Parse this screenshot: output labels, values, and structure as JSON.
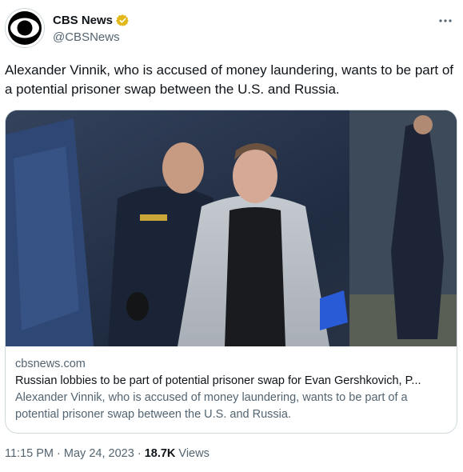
{
  "author": {
    "display_name": "CBS News",
    "handle": "@CBSNews",
    "avatar_icon": "cbs-eye-logo-icon",
    "verified_icon": "verified-gold-badge-icon",
    "verified_color": "#e2b719"
  },
  "more_icon": "more-options-icon",
  "tweet": {
    "text": "Alexander Vinnik, who is accused of money laundering, wants to be part of a potential prisoner swap between the U.S. and Russia."
  },
  "card": {
    "domain": "cbsnews.com",
    "title": "Russian lobbies to be part of potential prisoner swap for Evan Gershkovich, P...",
    "description": "Alexander Vinnik, who is accused of money laundering, wants to be part of a potential prisoner swap between the U.S. and Russia."
  },
  "footer": {
    "time": "11:15 PM",
    "separator": "·",
    "date": "May 24, 2023",
    "views_count": "18.7K",
    "views_label": "Views"
  },
  "colors": {
    "text_primary": "#0f1419",
    "text_secondary": "#536471",
    "border": "#cfd9de"
  }
}
